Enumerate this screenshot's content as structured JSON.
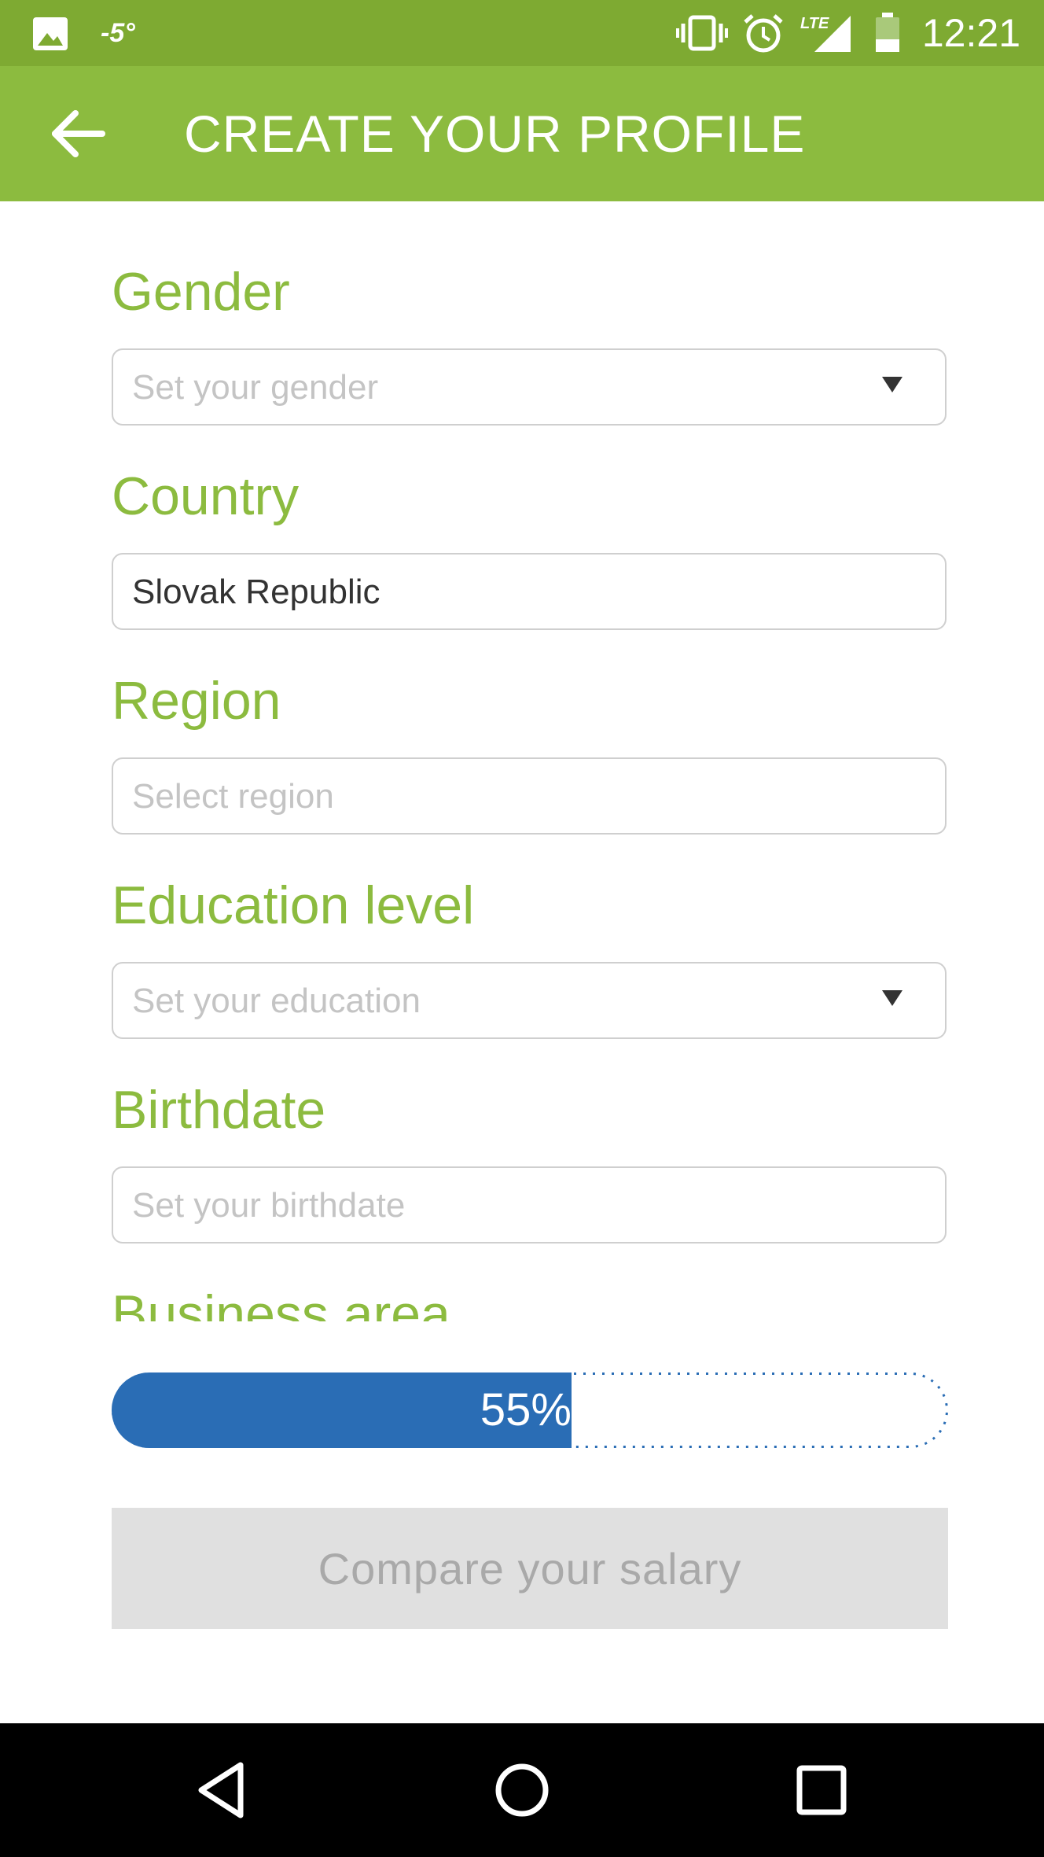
{
  "status_bar": {
    "temperature": "-5°",
    "time": "12:21",
    "network_label": "LTE",
    "icons": [
      "image-icon",
      "vibrate-icon",
      "alarm-icon",
      "lte-signal-icon",
      "battery-icon"
    ]
  },
  "app_bar": {
    "title": "CREATE YOUR PROFILE",
    "back_icon": "arrow-back-icon"
  },
  "form": {
    "gender": {
      "label": "Gender",
      "placeholder": "Set your gender",
      "value": ""
    },
    "country": {
      "label": "Country",
      "placeholder": "",
      "value": "Slovak Republic"
    },
    "region": {
      "label": "Region",
      "placeholder": "Select region",
      "value": ""
    },
    "education": {
      "label": "Education level",
      "placeholder": "Set your education",
      "value": ""
    },
    "birthdate": {
      "label": "Birthdate",
      "placeholder": "Set your birthdate",
      "value": ""
    },
    "business_area": {
      "label": "Business area"
    }
  },
  "progress": {
    "label": "55%",
    "fraction": 0.55
  },
  "compare_button": {
    "label": "Compare your salary"
  },
  "nav_bar": {
    "icons": [
      "back-triangle-icon",
      "home-circle-icon",
      "recents-square-icon"
    ]
  },
  "colors": {
    "status_bar": "#7eaa32",
    "app_bar": "#8cbb3f",
    "label_green": "#8cbb3f",
    "progress_blue": "#2a6db5",
    "button_disabled": "#e0e0e0"
  }
}
